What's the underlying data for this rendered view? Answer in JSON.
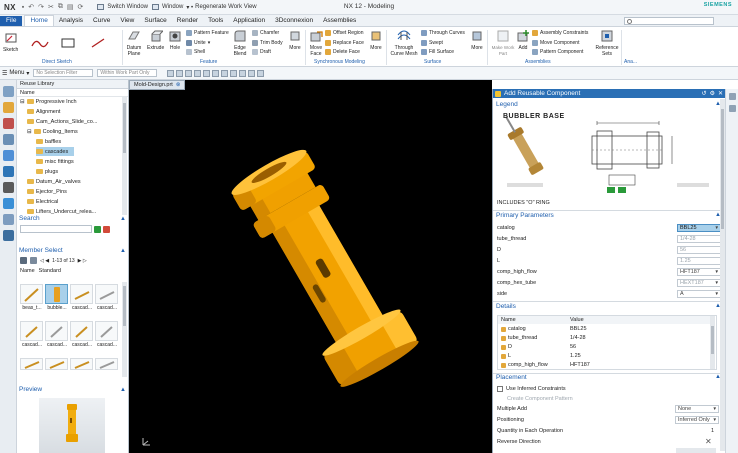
{
  "window": {
    "logo": "NX",
    "title": "NX 12 - Modeling",
    "brand": "SIEMENS",
    "switch_window": "Switch Window",
    "window_menu": "Window",
    "regenerate": "Regenerate Work View"
  },
  "tabs": [
    "File",
    "Home",
    "Analysis",
    "Curve",
    "View",
    "Surface",
    "Render",
    "Tools",
    "Application",
    "3Dconnexion",
    "Assemblies"
  ],
  "ribbon": {
    "sketch": "Sketch",
    "datum_plane": "Datum\nPlane",
    "extrude": "Extrude",
    "hole": "Hole",
    "pattern_feature": "Pattern Feature",
    "unite": "Unite",
    "shell": "Shell",
    "edge_blend": "Edge\nBlend",
    "chamfer": "Chamfer",
    "trim_body": "Trim Body",
    "draft": "Draft",
    "more1": "More",
    "move_face": "Move\nFace",
    "offset_region": "Offset Region",
    "replace_face": "Replace Face",
    "delete_face": "Delete Face",
    "more2": "More",
    "through_curve_mesh": "Through\nCurve Mesh",
    "through_curves": "Through Curves",
    "swept": "Swept",
    "fill_surface": "Fill Surface",
    "more3": "More",
    "add": "Add",
    "new_parent": "Make Work Part",
    "assembly_constraints": "Assembly Constraints",
    "move_component": "Move Component",
    "pattern_component": "Pattern Component",
    "reference_sets": "Reference\nSets",
    "groups": {
      "direct_sketch": "Direct Sketch",
      "feature": "Feature",
      "synchronous": "Synchronous Modeling",
      "surface": "Surface",
      "assemblies": "Assemblies",
      "analysis": "Ana..."
    }
  },
  "selbar": {
    "menu": "Menu",
    "filter_placeholder": "No Selection Filter",
    "scope": "Within Work Part Only"
  },
  "library": {
    "header": "Reuse Library",
    "name_col": "Name",
    "tree": [
      {
        "label": "Progressive Inch",
        "level": 0
      },
      {
        "label": "Alignment",
        "level": 1
      },
      {
        "label": "Cam_Actions_Slide_co...",
        "level": 1
      },
      {
        "label": "Cooling_Items",
        "level": 1
      },
      {
        "label": "baffles",
        "level": 2
      },
      {
        "label": "cascades",
        "level": 2,
        "selected": true
      },
      {
        "label": "misc fittings",
        "level": 2
      },
      {
        "label": "plugs",
        "level": 2
      },
      {
        "label": "Datum_Air_valves",
        "level": 1
      },
      {
        "label": "Ejector_Pins",
        "level": 1
      },
      {
        "label": "Electrical",
        "level": 1
      },
      {
        "label": "Lifters_Undercut_relea...",
        "level": 1
      }
    ],
    "search_title": "Search",
    "member_title": "Member Select",
    "pager": "1-13 of 13",
    "member_cols": [
      "Name",
      "Standard"
    ],
    "thumb_labels": [
      "beas_t...",
      "bubble...",
      "cascad...",
      "cascad..."
    ],
    "thumb_labels_row2": [
      "cascad...",
      "cascad...",
      "cascad...",
      "cascad..."
    ],
    "preview_title": "Preview"
  },
  "viewport": {
    "tab": "Mold-Design.prt"
  },
  "dialog": {
    "title": "Add Reusable Component",
    "legend_title": "Legend",
    "legend_brand": "BUBBLER BASE",
    "legend_note": "INCLUDES \"O\" RING",
    "primary_title": "Primary Parameters",
    "params": [
      {
        "label": "catalog",
        "value": "BBL25",
        "style": "hl",
        "dropdown": true
      },
      {
        "label": "tube_thread",
        "value": "1/4-28",
        "style": "dim"
      },
      {
        "label": "D",
        "value": "56",
        "style": "dim"
      },
      {
        "label": "L",
        "value": "1.25",
        "style": "dim"
      },
      {
        "label": "comp_high_flow",
        "value": "HFT187",
        "style": "",
        "dropdown": true
      },
      {
        "label": "comp_hex_tube",
        "value": "HEXT187",
        "style": "dim",
        "dropdown": true
      },
      {
        "label": "side",
        "value": "A",
        "style": "",
        "dropdown": true
      }
    ],
    "details_title": "Details",
    "details_cols": [
      "Name",
      "Value"
    ],
    "details": [
      {
        "name": "catalog",
        "value": "BBL25"
      },
      {
        "name": "tube_thread",
        "value": "1/4-28"
      },
      {
        "name": "D",
        "value": "56"
      },
      {
        "name": "L",
        "value": "1.25"
      },
      {
        "name": "comp_high_flow",
        "value": "HFT187"
      }
    ],
    "placement_title": "Placement",
    "use_inferred": "Use Inferred Constraints",
    "create_pattern": "Create Component Pattern",
    "multiple_add": "Multiple Add",
    "multiple_add_value": "None",
    "positioning": "Positioning",
    "positioning_value": "Inferred Only",
    "quantity": "Quantity in Each Operation",
    "quantity_value": "1",
    "reverse": "Reverse Direction"
  },
  "colors": {
    "accent": "#1f5fae",
    "title_bar": "#2a6fb5",
    "part": "#f0a000",
    "selection": "#a8d0ea"
  }
}
